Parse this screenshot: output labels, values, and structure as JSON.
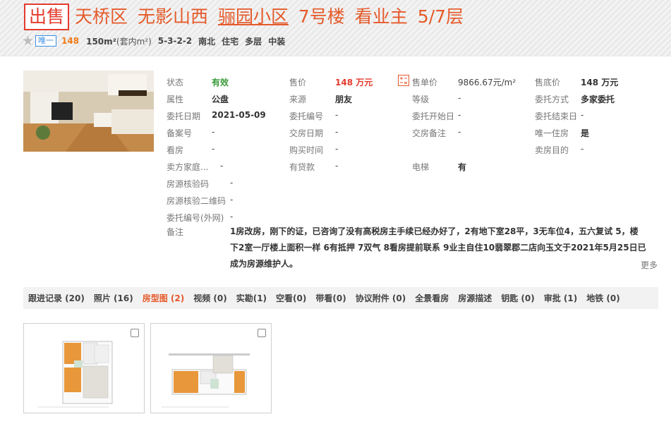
{
  "header": {
    "sale_badge": "出售",
    "district": "天桥区",
    "area": "无影山西",
    "community": "骊园小区",
    "building": "7号楼",
    "owner_tag": "看业主",
    "floor": "5/7层"
  },
  "subline": {
    "unique_badge": "唯一",
    "price": "148",
    "area": "150m²",
    "area_note": "(套内m²)",
    "layout": "5-3-2-2",
    "orientation": "南北",
    "usage": "住宅",
    "building_type": "多层",
    "decoration": "中装"
  },
  "info": {
    "status_label": "状态",
    "status_value": "有效",
    "price_label": "售价",
    "price_value": "148 万元",
    "unit_price_label": "售单价",
    "unit_price_value": "9866.67元/m²",
    "floor_price_label": "售底价",
    "floor_price_value": "148 万元",
    "ownership_label": "属性",
    "ownership_value": "公盘",
    "source_label": "来源",
    "source_value": "朋友",
    "grade_label": "等级",
    "grade_value": "-",
    "entrust_mode_label": "委托方式",
    "entrust_mode_value": "多家委托",
    "entrust_date_label": "委托日期",
    "entrust_date_value": "2021-05-09",
    "entrust_no_label": "委托编号",
    "entrust_no_value": "-",
    "entrust_start_label": "委托开始日",
    "entrust_start_value": "-",
    "entrust_end_label": "委托结束日",
    "entrust_end_value": "-",
    "record_no_label": "备案号",
    "record_no_value": "-",
    "handover_date_label": "交房日期",
    "handover_date_value": "-",
    "handover_note_label": "交房备注",
    "handover_note_value": "-",
    "only_house_label": "唯一住房",
    "only_house_value": "是",
    "viewing_label": "看房",
    "viewing_value": "-",
    "purchase_time_label": "购买时间",
    "purchase_time_value": "-",
    "sale_purpose_label": "卖房目的",
    "sale_purpose_value": "-",
    "seller_family_label": "卖方家庭...",
    "seller_family_value": "-",
    "loan_label": "有贷款",
    "loan_value": "-",
    "elevator_label": "电梯",
    "elevator_value": "有",
    "verify_code_label": "房源核验码",
    "verify_code_value": "-",
    "verify_qr_label": "房源核验二维码",
    "verify_qr_value": "-",
    "entrust_ext_label": "委托编号(外网)",
    "entrust_ext_value": "-",
    "remark_label": "备注",
    "remark_value": "1房改房，刚下的证，已咨询了没有高税房主手续已经办好了，2有地下室28平，3无车位4，五六复试 5，楼下2室一厅楼上面积一样 6有抵押 7双气 8看房提前联系 9业主自住10翡翠郡二店向玉文于2021年5月25日已成为房源维护人。",
    "more": "更多"
  },
  "tabs": [
    {
      "label": "跟进记录 (20)"
    },
    {
      "label": "照片 (16)"
    },
    {
      "label": "房型图 (2)"
    },
    {
      "label": "视频 (0)"
    },
    {
      "label": "实勘(1)"
    },
    {
      "label": "空看(0)"
    },
    {
      "label": "带看(0)"
    },
    {
      "label": "协议附件 (0)"
    },
    {
      "label": "全景看房"
    },
    {
      "label": "房源描述"
    },
    {
      "label": "钥匙 (0)"
    },
    {
      "label": "审批 (1)"
    },
    {
      "label": "地铁 (0)"
    }
  ],
  "active_tab": 2,
  "colors": {
    "accent": "#e55a2a",
    "sale_red": "#e43b2d",
    "valid_green": "#3a9a3a",
    "badge_blue": "#3a8ee6"
  }
}
